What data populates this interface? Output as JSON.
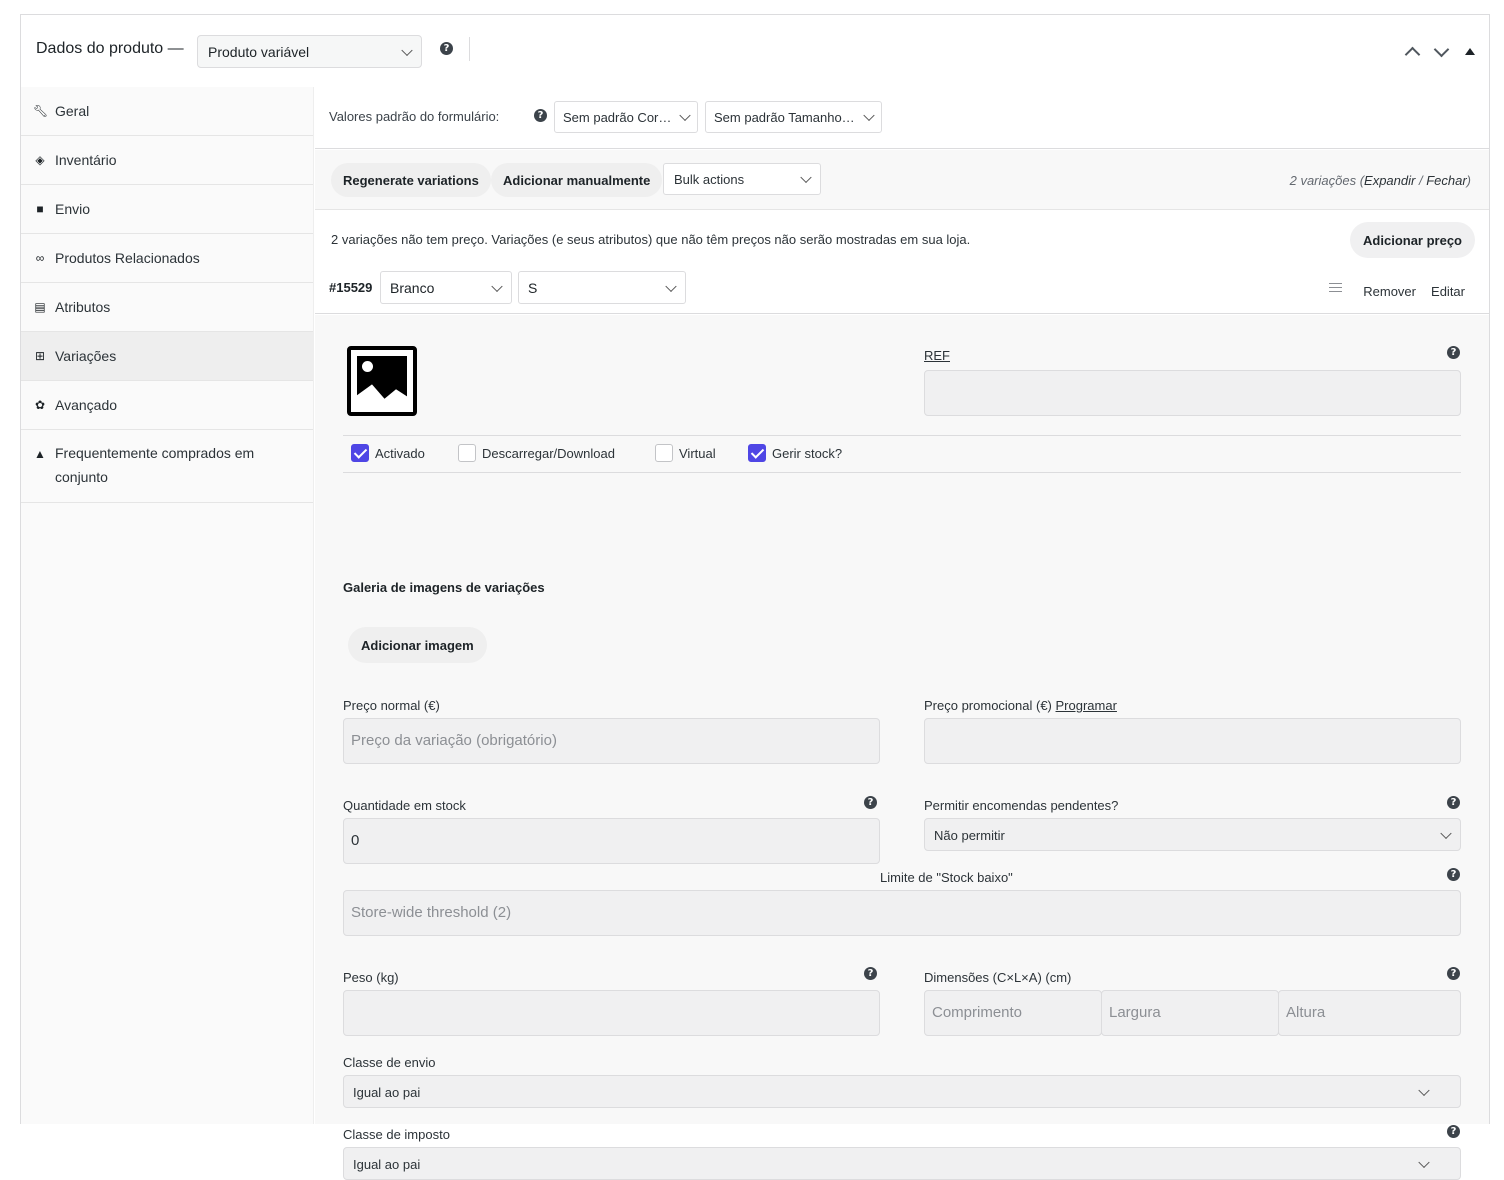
{
  "header": {
    "title": "Dados do produto —",
    "product_type": "Produto variável"
  },
  "sidebar": {
    "items": [
      {
        "label": "Geral",
        "icon": "wrench-icon"
      },
      {
        "label": "Inventário",
        "icon": "tag-icon"
      },
      {
        "label": "Envio",
        "icon": "truck-icon"
      },
      {
        "label": "Produtos Relacionados",
        "icon": "link-icon"
      },
      {
        "label": "Atributos",
        "icon": "list-icon"
      },
      {
        "label": "Variações",
        "icon": "grid-icon"
      },
      {
        "label": "Avançado",
        "icon": "gear-icon"
      },
      {
        "label": "Frequentemente comprados em conjunto",
        "icon": "bag-icon"
      }
    ]
  },
  "defaults": {
    "label": "Valores padrão do formulário:",
    "color_select": "Sem padrão Cor…",
    "size_select": "Sem padrão Tamanho…"
  },
  "toolbar": {
    "regenerate": "Regenerate variations",
    "add_manual": "Adicionar manualmente",
    "bulk_actions": "Bulk actions",
    "count_text": "2 variações (",
    "expand": "Expandir",
    "slash": " / ",
    "close": "Fechar",
    "close_paren": ")"
  },
  "notice": {
    "text": "2 variações não tem preço. Variações (e seus atributos) que não têm preços não serão mostradas em sua loja.",
    "add_price": "Adicionar preço"
  },
  "variation": {
    "id": "#15529",
    "color": "Branco",
    "size": "S",
    "remove": "Remover",
    "edit": "Editar"
  },
  "form": {
    "sku_label": "REF",
    "options": {
      "enabled": {
        "label": "Activado",
        "checked": true
      },
      "downloadable": {
        "label": "Descarregar/Download",
        "checked": false
      },
      "virtual": {
        "label": "Virtual",
        "checked": false
      },
      "manage_stock": {
        "label": "Gerir stock?",
        "checked": true
      }
    },
    "gallery_title": "Galeria de imagens de variações",
    "add_image": "Adicionar imagem",
    "regular_price_label": "Preço normal (€)",
    "regular_price_placeholder": "Preço da variação (obrigatório)",
    "sale_price_label": "Preço promocional (€)",
    "schedule_link": "Programar",
    "stock_qty_label": "Quantidade em stock",
    "stock_qty_value": "0",
    "backorders_label": "Permitir encomendas pendentes?",
    "backorders_value": "Não permitir",
    "low_stock_label": "Limite de \"Stock baixo\"",
    "low_stock_placeholder": "Store-wide threshold (2)",
    "weight_label": "Peso (kg)",
    "dimensions_label": "Dimensões (C×L×A) (cm)",
    "length_placeholder": "Comprimento",
    "width_placeholder": "Largura",
    "height_placeholder": "Altura",
    "shipping_class_label": "Classe de envio",
    "shipping_class_value": "Igual ao pai",
    "tax_class_label": "Classe de imposto",
    "tax_class_value": "Igual ao pai"
  },
  "colors": {
    "accent": "#4f46e5",
    "border": "#dcdcde",
    "input_bg": "#f0f0f1"
  }
}
